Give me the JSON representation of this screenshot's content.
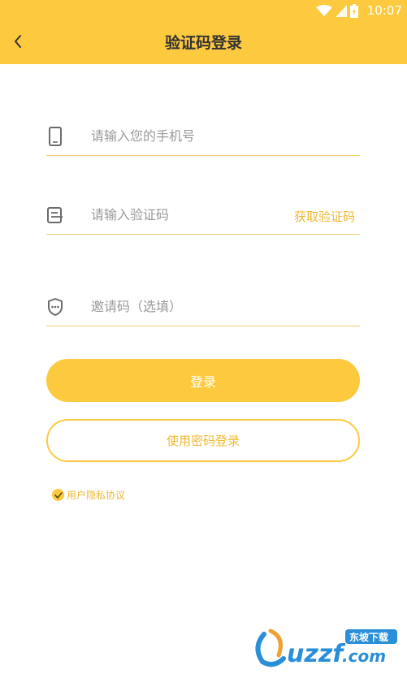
{
  "status_bar": {
    "time": "10:07"
  },
  "header": {
    "title": "验证码登录"
  },
  "form": {
    "phone_placeholder": "请输入您的手机号",
    "code_placeholder": "请输入验证码",
    "get_code_label": "获取验证码",
    "invite_placeholder": "邀请码（选填）"
  },
  "buttons": {
    "login_label": "登录",
    "password_login_label": "使用密码登录"
  },
  "agreement": {
    "label": "用户隐私协议",
    "checked": true
  },
  "watermark": {
    "text": "uzzf.com",
    "tag": "东坡下载"
  },
  "colors": {
    "accent": "#fcc93f",
    "accent_text": "#f0b830"
  }
}
